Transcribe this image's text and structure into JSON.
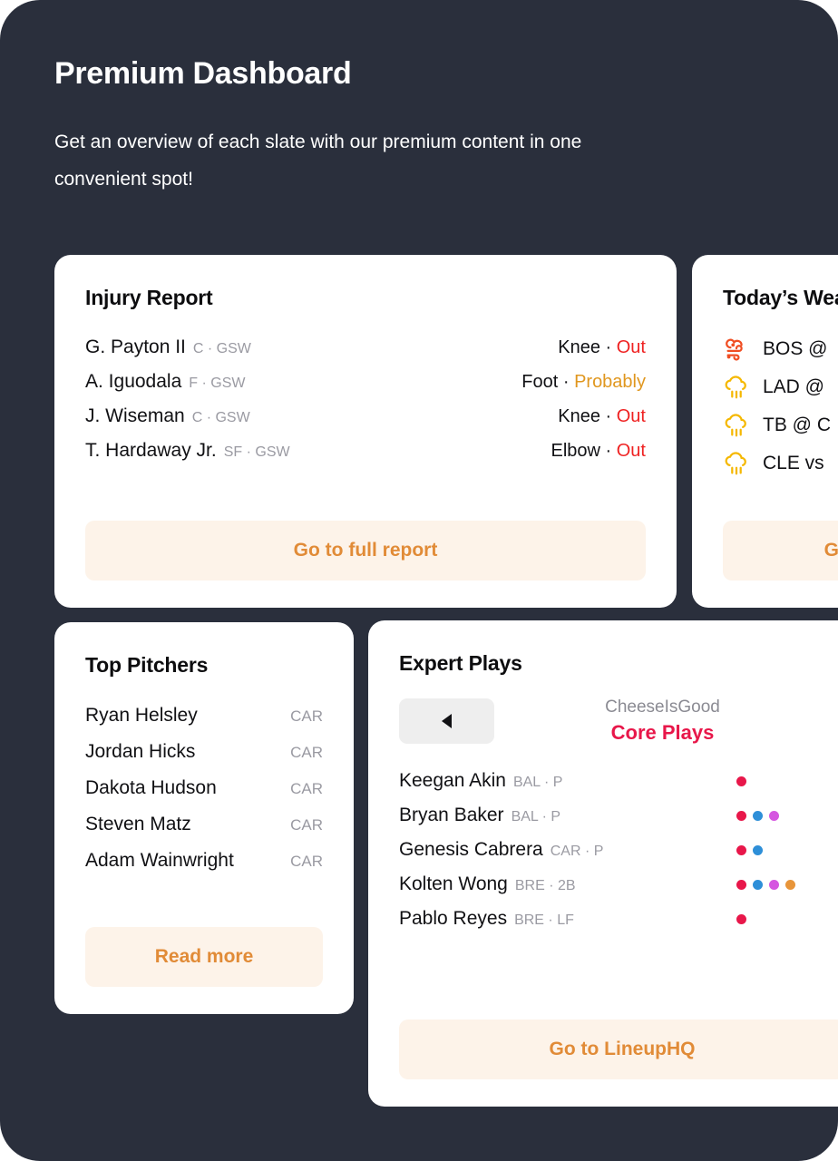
{
  "header": {
    "title": "Premium Dashboard",
    "subtitle": "Get an overview of each slate with our premium content in one convenient spot!"
  },
  "colors": {
    "background": "#2a2f3c",
    "card": "#ffffff",
    "accent_orange": "#e18b37",
    "cta_background": "#fdf3e9",
    "status_out": "#ef2222",
    "status_probable": "#e0971f",
    "core_plays_red": "#e8174a",
    "dot_red": "#e8174a",
    "dot_blue": "#2e8fd8",
    "dot_purple": "#d556e0",
    "dot_orange": "#e8953a",
    "weather_wind": "#f04e23",
    "weather_rain": "#f5b800",
    "muted_text": "#9a9aa2"
  },
  "injury_card": {
    "title": "Injury Report",
    "rows": [
      {
        "name": "G. Payton II",
        "meta": "C · GSW",
        "body_part": "Knee",
        "sep": "·",
        "status": "Out",
        "status_kind": "out"
      },
      {
        "name": "A. Iguodala",
        "meta": "F · GSW",
        "body_part": "Foot",
        "sep": "·",
        "status": "Probably",
        "status_kind": "probable"
      },
      {
        "name": "J. Wiseman",
        "meta": "C · GSW",
        "body_part": "Knee",
        "sep": "·",
        "status": "Out",
        "status_kind": "out"
      },
      {
        "name": "T. Hardaway Jr.",
        "meta": "SF · GSW",
        "body_part": "Elbow",
        "sep": "·",
        "status": "Out",
        "status_kind": "out"
      }
    ],
    "cta_label": "Go to full report"
  },
  "weather_card": {
    "title": "Today’s Weather",
    "rows": [
      {
        "icon": "wind-cloud-icon",
        "matchup": "BOS @ ",
        "icon_color": "#f04e23"
      },
      {
        "icon": "rain-cloud-icon",
        "matchup": "LAD @ ",
        "icon_color": "#f5b800"
      },
      {
        "icon": "rain-cloud-icon",
        "matchup": "TB @ C",
        "icon_color": "#f5b800"
      },
      {
        "icon": "rain-cloud-icon",
        "matchup": "CLE vs",
        "icon_color": "#f5b800"
      }
    ],
    "cta_label": "Go to full report"
  },
  "pitchers_card": {
    "title": "Top Pitchers",
    "rows": [
      {
        "name": "Ryan Helsley",
        "team": "CAR"
      },
      {
        "name": "Jordan Hicks",
        "team": "CAR"
      },
      {
        "name": "Dakota Hudson",
        "team": "CAR"
      },
      {
        "name": "Steven Matz",
        "team": "CAR"
      },
      {
        "name": "Adam Wainwright",
        "team": "CAR"
      }
    ],
    "cta_label": "Read more"
  },
  "experts_card": {
    "title": "Expert Plays",
    "prev_button_icon": "triangle-left-icon",
    "username": "CheeseIsGood",
    "category": "Core Plays",
    "rows": [
      {
        "name": "Keegan Akin",
        "meta": "BAL · P",
        "dots": [
          "#e8174a"
        ]
      },
      {
        "name": "Bryan Baker",
        "meta": "BAL · P",
        "dots": [
          "#e8174a",
          "#2e8fd8",
          "#d556e0"
        ]
      },
      {
        "name": "Genesis Cabrera",
        "meta": "CAR · P",
        "dots": [
          "#e8174a",
          "#2e8fd8"
        ]
      },
      {
        "name": "Kolten Wong",
        "meta": "BRE · 2B",
        "dots": [
          "#e8174a",
          "#2e8fd8",
          "#d556e0",
          "#e8953a"
        ]
      },
      {
        "name": "Pablo Reyes",
        "meta": "BRE · LF",
        "dots": [
          "#e8174a"
        ]
      }
    ],
    "cta_label": "Go to LineupHQ"
  }
}
